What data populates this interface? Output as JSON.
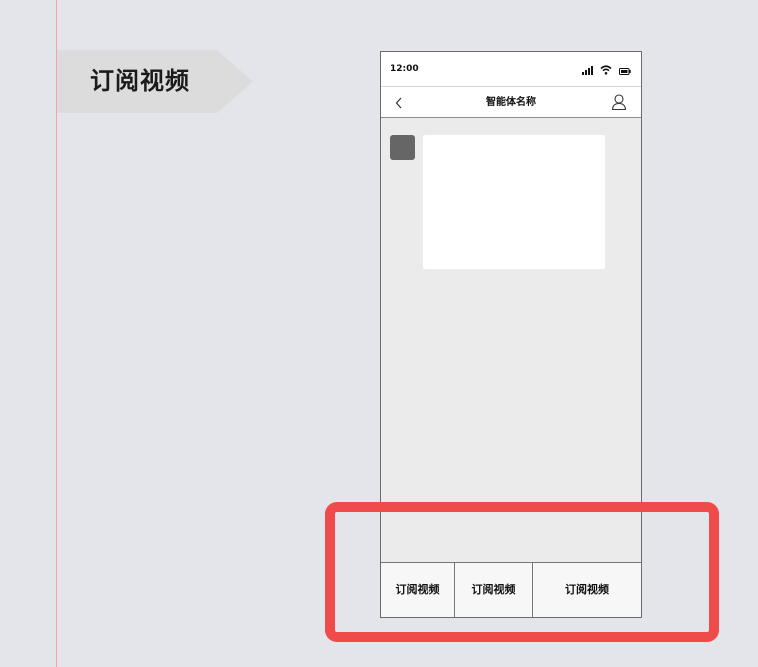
{
  "page_tag": {
    "label": "订阅视频"
  },
  "status_bar": {
    "time": "12:00",
    "icons": [
      "signal-icon",
      "wifi-icon",
      "battery-icon"
    ]
  },
  "nav_bar": {
    "title": "智能体名称",
    "back_icon": "chevron-left-icon",
    "profile_icon": "user-icon"
  },
  "chat": {
    "avatar_color": "#666666",
    "bubble_color": "#ffffff"
  },
  "bottom_menu": {
    "items": [
      {
        "label": "订阅视频"
      },
      {
        "label": "订阅视频"
      },
      {
        "label": "订阅视频"
      }
    ]
  },
  "colors": {
    "canvas_background": "#e4e5ea",
    "phone_background": "#ebebeb",
    "highlight": "#f04b4b",
    "guide_line": "#f0a6a2",
    "tag_background": "#dcdcdc"
  }
}
